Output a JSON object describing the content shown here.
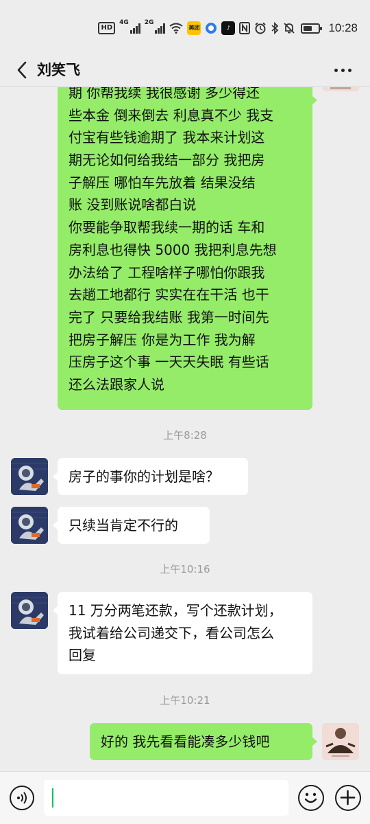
{
  "status_bar": {
    "hd": "HD",
    "net1": "4G",
    "net2": "2G",
    "app1": "美团",
    "time": "10:28",
    "battery_level": 0.6
  },
  "header": {
    "title": "刘笑飞"
  },
  "messages": {
    "m1_lines": [
      "期 你帮我续  我很感谢   多少得还",
      "些本金 倒来倒去  利息真不少 我支",
      "付宝有些钱逾期了   我本来计划这",
      "期无论如何给我结一部分  我把房",
      "子解压 哪怕车先放着  结果没结",
      "账   没到账说啥都白说",
      "你要能争取帮我续一期的话  车和",
      "房利息也得快 5000 我把利息先想",
      "办法给了   工程啥样子哪怕你跟我",
      "去趟工地都行  实实在在干活 也干",
      "完了  只要给我结账  我第一时间先",
      "把房子解压    你是为工作  我为解",
      "压房子这个事   一天天失眠  有些话",
      "还么法跟家人说"
    ],
    "ts1": "上午8:28",
    "m2": "房子的事你的计划是啥？",
    "m3": "只续当肯定不行的",
    "ts2": "上午10:16",
    "m4_lines": [
      "11 万分两笔还款，写个还款计划，",
      "我试着给公司递交下，看公司怎么",
      "回复"
    ],
    "ts3": "上午10:21",
    "m5": "好的  我先看看能凑多少钱吧"
  },
  "input": {
    "value": ""
  }
}
